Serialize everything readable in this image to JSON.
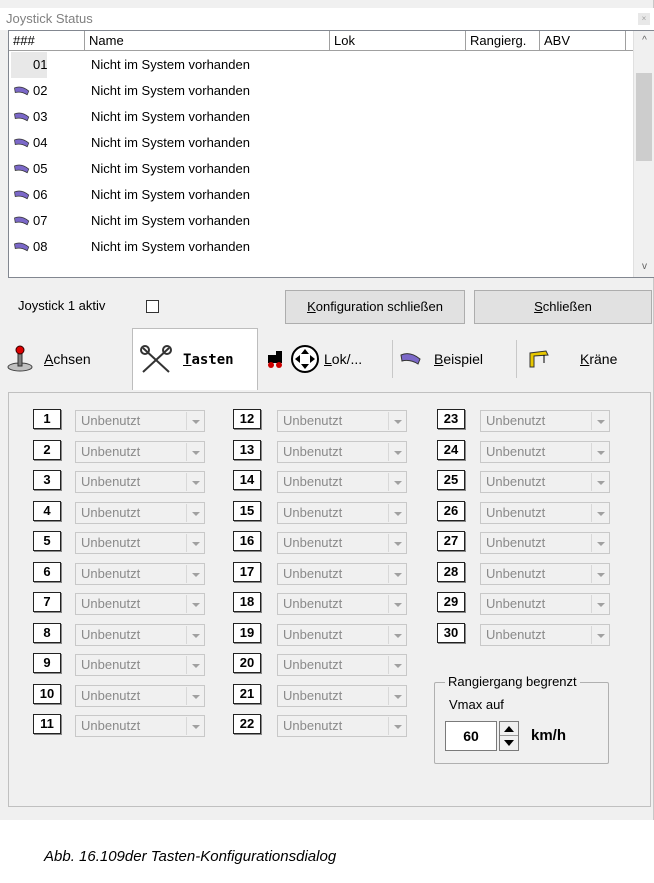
{
  "window": {
    "title": "Joystick Status",
    "close_glyph": "×"
  },
  "list": {
    "columns": [
      "###",
      "Name",
      "Lok",
      "Rangierg.",
      "ABV"
    ],
    "rows": [
      {
        "num": "01",
        "name": "Nicht im System vorhanden"
      },
      {
        "num": "02",
        "name": "Nicht im System vorhanden"
      },
      {
        "num": "03",
        "name": "Nicht im System vorhanden"
      },
      {
        "num": "04",
        "name": "Nicht im System vorhanden"
      },
      {
        "num": "05",
        "name": "Nicht im System vorhanden"
      },
      {
        "num": "06",
        "name": "Nicht im System vorhanden"
      },
      {
        "num": "07",
        "name": "Nicht im System vorhanden"
      },
      {
        "num": "08",
        "name": "Nicht im System vorhanden"
      }
    ],
    "scroll_up": "^",
    "scroll_down": "v"
  },
  "status": {
    "joystick_label": "Joystick 1 aktiv",
    "close_config_k": "K",
    "close_config_rest": "onfiguration schließen",
    "close_s": "S",
    "close_rest": "chließen"
  },
  "tabs": {
    "achsen_u": "A",
    "achsen_rest": "chsen",
    "tasten_u": "T",
    "tasten_rest": "asten",
    "lok_u": "L",
    "lok_rest": "ok/...",
    "beispiel_u": "B",
    "beispiel_rest": "eispiel",
    "kraene_u": "K",
    "kraene_rest": "räne"
  },
  "buttons": {
    "col1": [
      "1",
      "2",
      "3",
      "4",
      "5",
      "6",
      "7",
      "8",
      "9",
      "10",
      "11"
    ],
    "col2": [
      "12",
      "13",
      "14",
      "15",
      "16",
      "17",
      "18",
      "19",
      "20",
      "21",
      "22"
    ],
    "col3": [
      "23",
      "24",
      "25",
      "26",
      "27",
      "28",
      "29",
      "30"
    ],
    "default_value": "Unbenutzt"
  },
  "shunting": {
    "legend": "Rangiergang begrenzt",
    "vmax_label": "Vmax auf",
    "value": "60",
    "unit": "km/h"
  },
  "caption": "Abb. 16.109der Tasten-Konfigurationsdialog",
  "colors": {
    "panel": "#f0f0f0",
    "disabled_text": "#8a8a8a",
    "joystick_icon": "#7b68c8"
  }
}
